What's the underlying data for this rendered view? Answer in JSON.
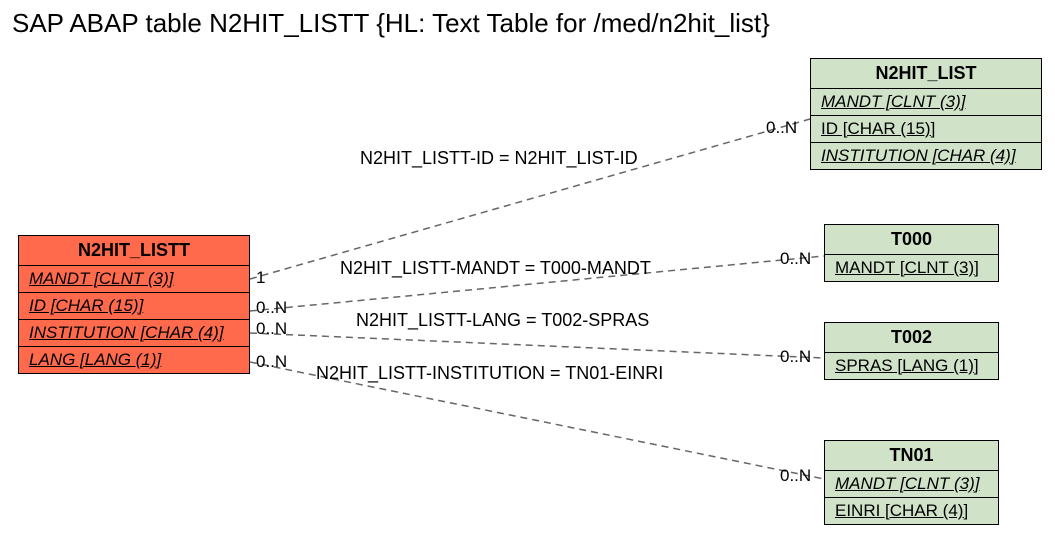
{
  "title": "SAP ABAP table N2HIT_LISTT {HL: Text Table for /med/n2hit_list}",
  "entities": {
    "main": {
      "name": "N2HIT_LISTT",
      "fields": [
        "MANDT [CLNT (3)]",
        "ID [CHAR (15)]",
        "INSTITUTION [CHAR (4)]",
        "LANG [LANG (1)]"
      ]
    },
    "e1": {
      "name": "N2HIT_LIST",
      "fields": [
        "MANDT [CLNT (3)]",
        "ID [CHAR (15)]",
        "INSTITUTION [CHAR (4)]"
      ]
    },
    "e2": {
      "name": "T000",
      "fields": [
        "MANDT [CLNT (3)]"
      ]
    },
    "e3": {
      "name": "T002",
      "fields": [
        "SPRAS [LANG (1)]"
      ]
    },
    "e4": {
      "name": "TN01",
      "fields": [
        "MANDT [CLNT (3)]",
        "EINRI [CHAR (4)]"
      ]
    }
  },
  "relations": {
    "r1": "N2HIT_LISTT-ID = N2HIT_LIST-ID",
    "r2": "N2HIT_LISTT-MANDT = T000-MANDT",
    "r3": "N2HIT_LISTT-LANG = T002-SPRAS",
    "r4": "N2HIT_LISTT-INSTITUTION = TN01-EINRI"
  },
  "cards": {
    "left_r1": "1",
    "left_r2": "0..N",
    "left_r3": "0..N",
    "left_r4": "0..N",
    "right_r1": "0..N",
    "right_r2": "0..N",
    "right_r3": "0..N",
    "right_r4": "0..N"
  }
}
